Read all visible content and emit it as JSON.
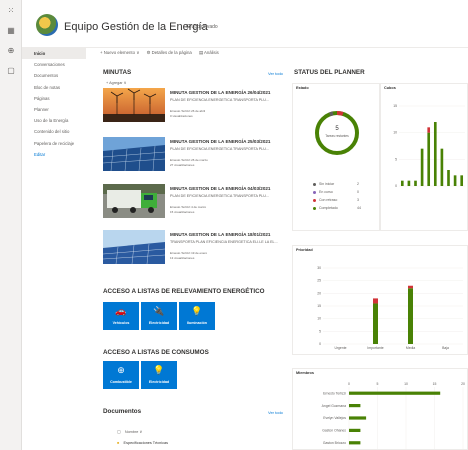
{
  "site": {
    "title": "Equipo Gestión de la Energía",
    "privacy": "Grupo privado"
  },
  "appbar": {
    "icons": [
      "waffle-icon",
      "grid-icon",
      "globe-icon",
      "page-icon"
    ]
  },
  "nav": {
    "items": [
      {
        "label": "Inicio",
        "active": true
      },
      {
        "label": "Conversaciones"
      },
      {
        "label": "Documentos"
      },
      {
        "label": "Bloc de notas"
      },
      {
        "label": "Páginas"
      },
      {
        "label": "Planner"
      },
      {
        "label": "Uso de la Energía"
      },
      {
        "label": "Contenido del sitio"
      },
      {
        "label": "Papelera de reciclaje"
      },
      {
        "label": "Editar",
        "edit": true
      }
    ]
  },
  "cmdbar": {
    "new": "+ Nuevo elemento ∨",
    "details": "⚙ Detalles de la página",
    "analytics": "▤ Análisis"
  },
  "news": {
    "title": "MINUTAS",
    "see_all": "Ver todo",
    "add": "+ Agregar ∨",
    "items": [
      {
        "title": "MINUTA GESTION DE LA ENERGÍA 26/04/2021",
        "desc": "PLAN DE EFICIENCIA ENERGETICA TRANSPORTA PLU...",
        "author": "Ernesto Terlizzi 26 de abril",
        "views": "0 visualizaciones",
        "img": "turbines"
      },
      {
        "title": "MINUTA GESTION DE LA ENERGÍA 25/03/2021",
        "desc": "PLAN DE EFICIENCIA ENERGETICA TRANSPORTA PLU...",
        "author": "Ernesto Terlizzi 26 de marzo",
        "views": "27 visualizaciones",
        "img": "solar"
      },
      {
        "title": "MINUTA GESTION DE LA ENERGÍA 04/03/2021",
        "desc": "PLAN DE EFICIENCIA ENERGETICA TRANSPORTA PLU...",
        "author": "Ernesto Terlizzi 4 de marzo",
        "views": "15 visualizaciones",
        "img": "truck"
      },
      {
        "title": "MINUTA GESTION DE LA ENERGÍA 18/01/2021",
        "desc": "TRANSPORTA PLAN EFICIENCIA ENERGETICA ELI.LE LA EL...",
        "author": "Ernesto Terlizzi 19 de enero",
        "views": "13 visualizaciones",
        "img": "panels"
      }
    ]
  },
  "relevamiento": {
    "title": "ACCESO A LISTAS DE RELEVAMIENTO ENERGÉTICO",
    "tiles": [
      {
        "label": "Vehículos",
        "icon": "car-icon"
      },
      {
        "label": "Electricidad",
        "icon": "plug-icon"
      },
      {
        "label": "Iluminación",
        "icon": "bulb-icon"
      }
    ]
  },
  "consumos": {
    "title": "ACCESO A LISTAS DE CONSUMOS",
    "tiles": [
      {
        "label": "Combustible",
        "icon": "globe-icon"
      },
      {
        "label": "Electricidad",
        "icon": "bulb-icon"
      }
    ]
  },
  "documents": {
    "title": "Documentos",
    "see_all": "Ver todo",
    "header": "Nombre ∨",
    "rows": [
      {
        "name": "Especificaciones Técnicas"
      }
    ]
  },
  "planner": {
    "title": "STATUS DEL PLANNER",
    "estado": {
      "title": "Estado",
      "total": "5",
      "total_label": "Tareas restantes",
      "legend": [
        {
          "label": "Sin iniciar",
          "value": "2",
          "color": "#605e5c"
        },
        {
          "label": "En curso",
          "value": "0",
          "color": "#8764b8"
        },
        {
          "label": "Con retraso",
          "value": "3",
          "color": "#d13438"
        },
        {
          "label": "Completado",
          "value": "44",
          "color": "#498205"
        }
      ]
    },
    "cubos": {
      "title": "Cubos"
    },
    "prioridad": {
      "title": "Prioridad"
    },
    "miembros": {
      "title": "Miembros"
    }
  },
  "chart_data": [
    {
      "type": "bar",
      "title": "Cubos",
      "categories": [
        "c1",
        "c2",
        "c3",
        "c4",
        "c5",
        "c6",
        "c7",
        "c8",
        "c9",
        "c10"
      ],
      "series": [
        {
          "values": [
            1,
            1,
            1,
            7,
            10,
            12,
            7,
            3,
            2,
            2
          ],
          "color": "#498205"
        },
        {
          "values": [
            0,
            0,
            0,
            0,
            1,
            0,
            0,
            0,
            0,
            0
          ],
          "color": "#d13438"
        }
      ],
      "ylim": [
        0,
        15
      ],
      "yticks": [
        0,
        5,
        10,
        15
      ]
    },
    {
      "type": "bar",
      "title": "Prioridad",
      "categories": [
        "Urgente",
        "Importante",
        "Media",
        "Baja"
      ],
      "series": [
        {
          "values": [
            0,
            16,
            22,
            0
          ],
          "color": "#498205"
        },
        {
          "values": [
            0,
            2,
            1,
            0
          ],
          "color": "#d13438"
        }
      ],
      "ylim": [
        0,
        30
      ],
      "yticks": [
        0,
        5,
        10,
        15,
        20,
        25,
        30
      ]
    },
    {
      "type": "bar",
      "title": "Miembros",
      "categories": [
        "Ernesto Terlizzi",
        "Angel Guzmana",
        "Evelyn Vallejos",
        "Gaston Ohanes",
        "Gaston Briozzo"
      ],
      "values": [
        16,
        2,
        3,
        2,
        2
      ],
      "xlim": [
        0,
        20
      ],
      "xticks": [
        0,
        5,
        10,
        15,
        20
      ],
      "color": "#498205"
    }
  ]
}
